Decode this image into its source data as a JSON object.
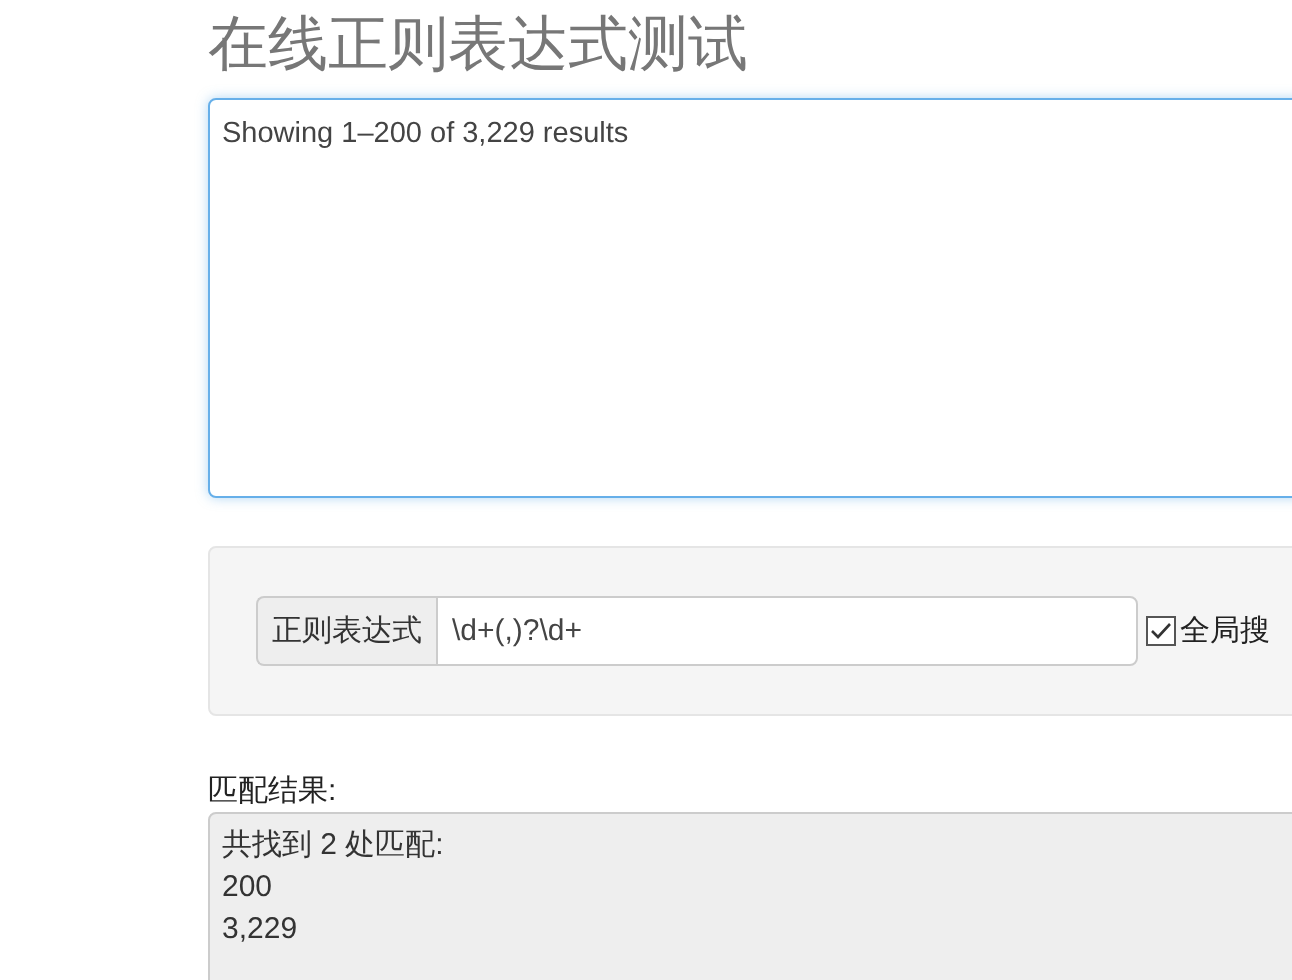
{
  "title": "在线正则表达式测试",
  "source_text": {
    "value": "Showing 1–200 of 3,229 results"
  },
  "regex": {
    "label": "正则表达式",
    "value": "\\d+(,)?\\d+"
  },
  "global_search": {
    "label": "全局搜",
    "checked": true
  },
  "result": {
    "label": "匹配结果:",
    "lines": [
      "共找到 2 处匹配:",
      "200",
      "3,229"
    ]
  }
}
